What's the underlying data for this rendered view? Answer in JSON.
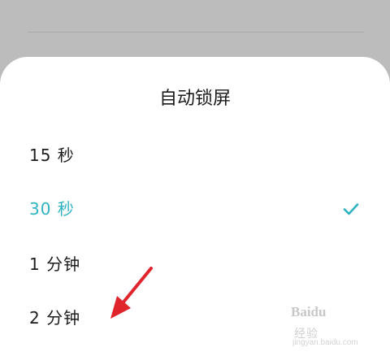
{
  "dialog": {
    "title": "自动锁屏",
    "options": [
      {
        "label": "15 秒",
        "selected": false
      },
      {
        "label": "30 秒",
        "selected": true
      },
      {
        "label": "1 分钟",
        "selected": false
      },
      {
        "label": "2 分钟",
        "selected": false
      }
    ]
  },
  "icons": {
    "selected_marker": "check-icon",
    "annotation": "red-arrow-icon"
  },
  "colors": {
    "accent": "#2fb3c2",
    "arrow": "#e0242c",
    "backdrop": "#bcbcbc",
    "sheet": "#ffffff"
  },
  "watermark": {
    "brand": "Baidu",
    "sub": "经验",
    "domain": "jingyan.baidu.com"
  }
}
